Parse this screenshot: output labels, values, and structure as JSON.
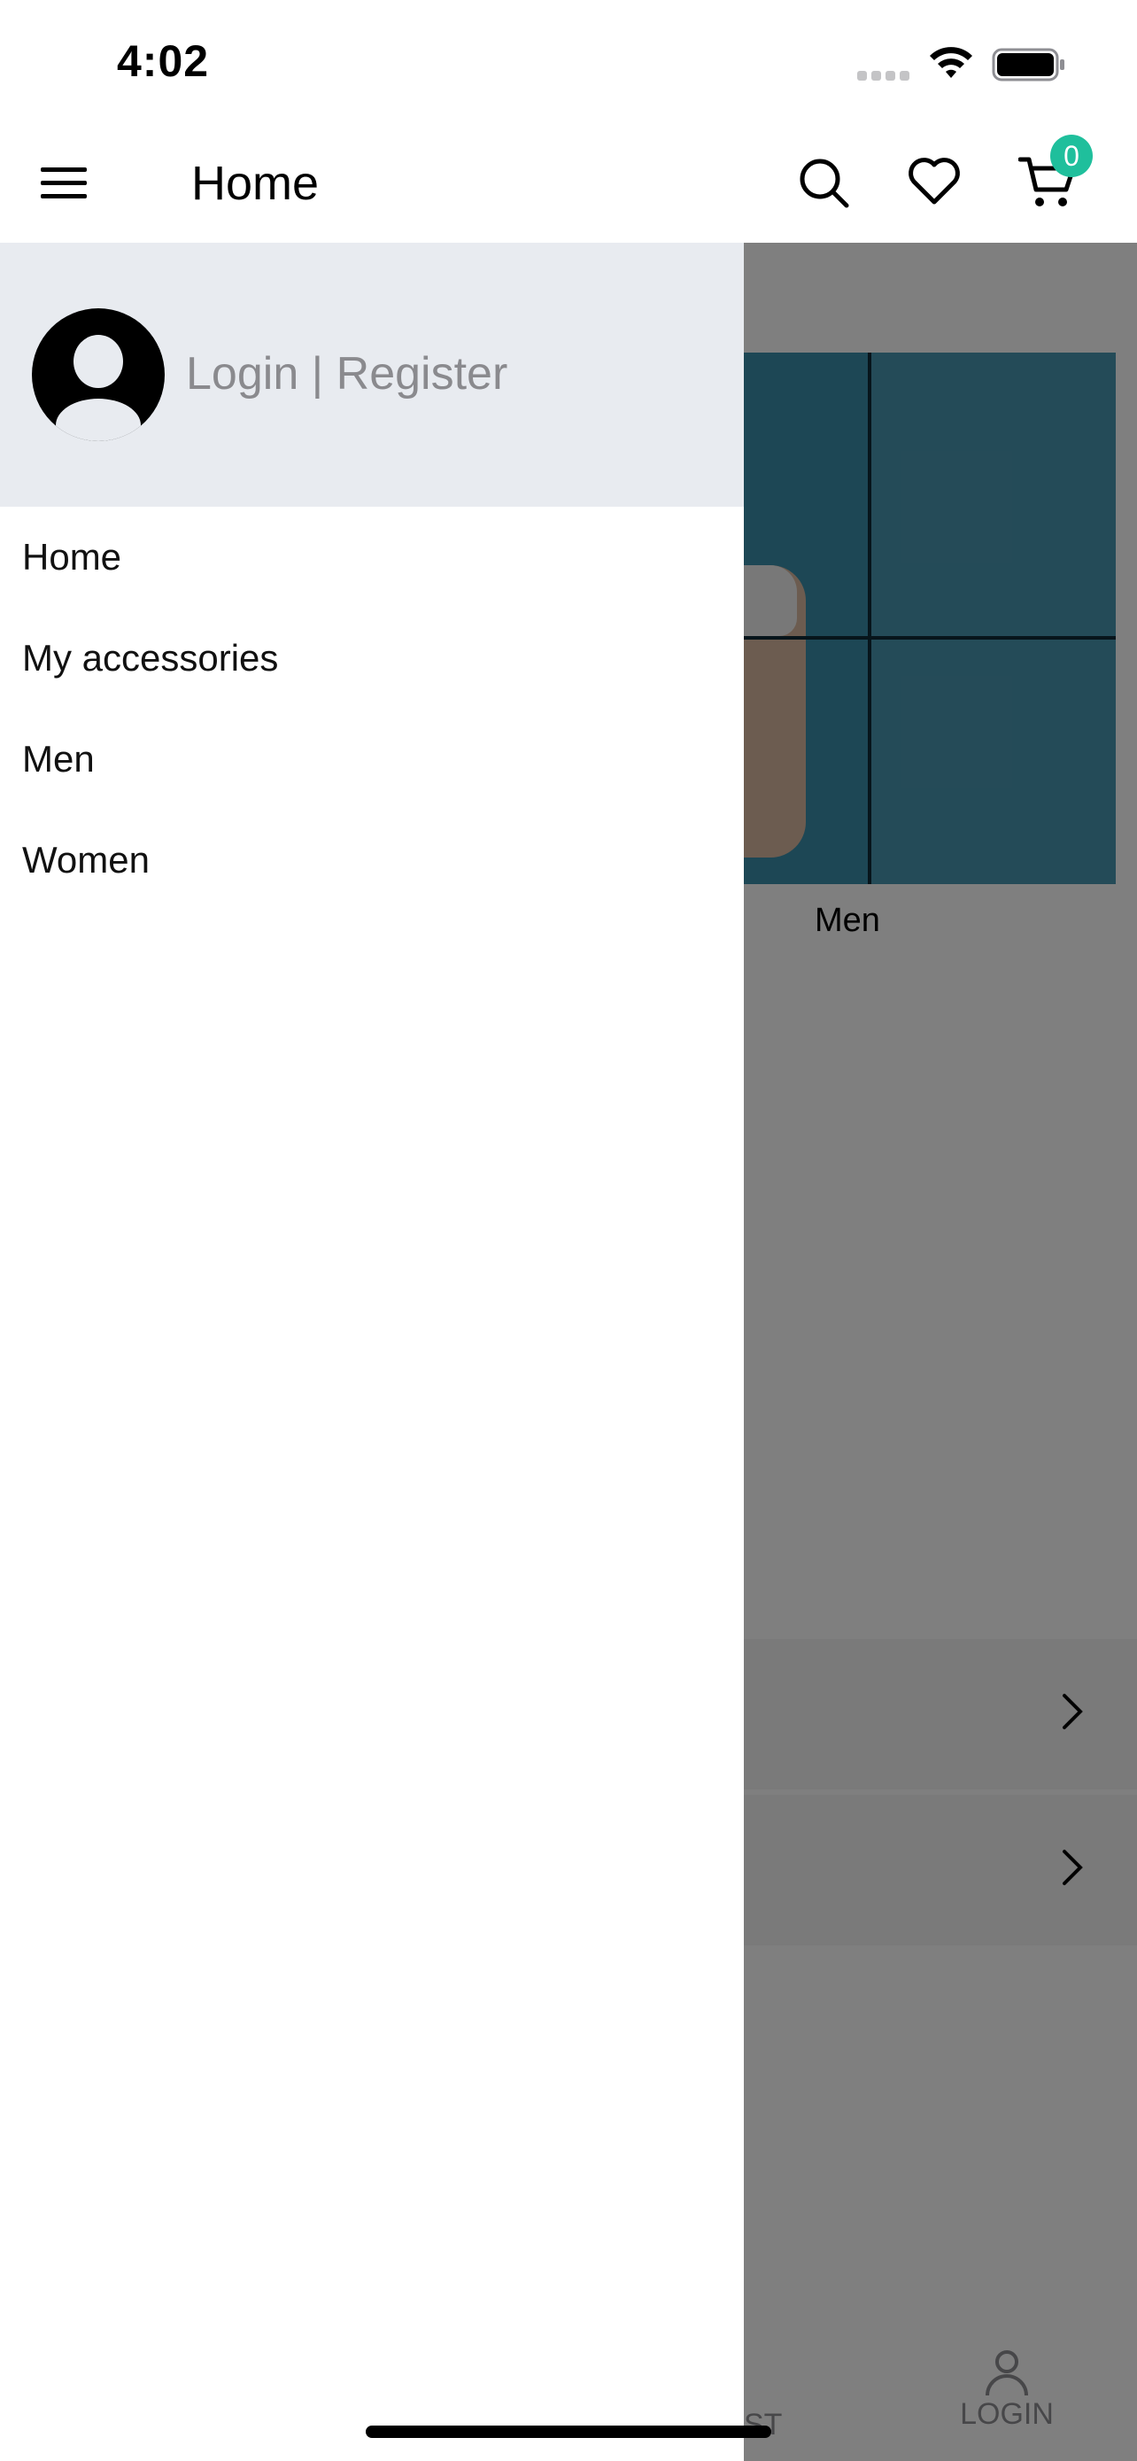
{
  "status_bar": {
    "time": "4:02"
  },
  "header": {
    "title": "Home",
    "cart_count": "0"
  },
  "drawer": {
    "login_register": "Login | Register",
    "items": [
      {
        "label": "Home"
      },
      {
        "label": "My accessories"
      },
      {
        "label": "Men"
      },
      {
        "label": "Women"
      }
    ]
  },
  "background": {
    "banner_label": "Men",
    "tab_partial_label": "ST",
    "tab_login_label": "LOGIN"
  },
  "colors": {
    "badge": "#1fbf9c",
    "drawer_header": "#e8ebf0",
    "scrim": "rgba(0,0,0,0.5)"
  },
  "icons": [
    "menu-icon",
    "search-icon",
    "heart-icon",
    "cart-icon",
    "avatar-icon",
    "wifi-icon",
    "battery-icon",
    "chevron-right-icon",
    "person-icon"
  ]
}
